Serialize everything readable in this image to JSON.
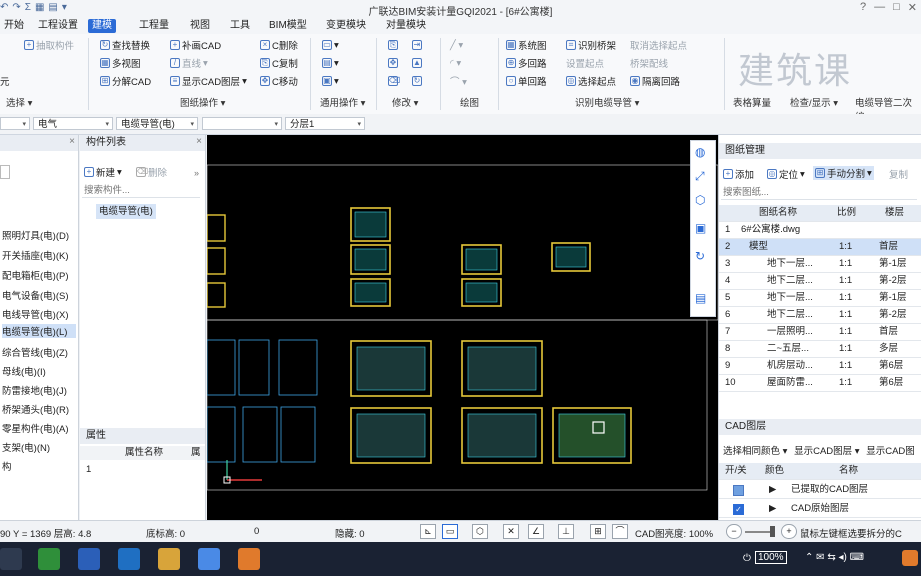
{
  "app_title": "广联达BIM安装计量GQI2021 - [6#公寓楼]",
  "window_controls": [
    "?",
    "—",
    "□",
    "✕"
  ],
  "menu": {
    "tabs": [
      "开始",
      "工程设置",
      "建模",
      "工程量",
      "视图",
      "工具",
      "BIM模型",
      "变更模块",
      "对量模块"
    ],
    "active_index": 2
  },
  "ribbon": {
    "left_partial": {
      "extract_component": "抽取构件",
      "yuan": "元",
      "group_label": "选择"
    },
    "drawing_ops": {
      "find_replace": "查找替换",
      "supplement_cad": "补画CAD",
      "c_delete": "C删除",
      "multi_view": "多视图",
      "line": "直线",
      "c_copy": "C复制",
      "split_cad": "分解CAD",
      "show_cad_layer": "显示CAD图层",
      "c_move": "C移动",
      "group_label": "图纸操作"
    },
    "general_ops_label": "通用操作",
    "modify_label": "修改",
    "draw_label": "绘图",
    "identify_conduit": {
      "system_diagram": "系统图",
      "identify_bridge": "识别桥架",
      "cancel_select_start": "取消选择起点",
      "multi_circuit": "多回路",
      "set_start": "设置起点",
      "bridge_check": "桥架配线",
      "single_circuit": "单回路",
      "select_start": "选择起点",
      "isolate_circuit": "隔离回路",
      "group_label": "识别电缆导管"
    },
    "table_calc_label": "表格算量",
    "check_show_label": "检查/显示",
    "conduit_secondary_label": "电缆导管二次编",
    "watermark": "建筑课"
  },
  "combos": [
    {
      "value": "",
      "name": "combo-blank"
    },
    {
      "value": "电气"
    },
    {
      "value": "电缆导管(电)"
    },
    {
      "value": ""
    },
    {
      "value": "分层1"
    }
  ],
  "left_tree": {
    "items": [
      "照明灯具(电)(D)",
      "开关插座(电)(K)",
      "配电箱柜(电)(P)",
      "电气设备(电)(S)",
      "电线导管(电)(X)",
      "电缆导管(电)(L)",
      "综合管线(电)(Z)",
      "母线(电)(I)",
      "防雷接地(电)(J)",
      "桥架通头(电)(R)",
      "零星构件(电)(A)",
      "支架(电)(N)",
      "构"
    ],
    "selected_index": 5
  },
  "component_list": {
    "title": "构件列表",
    "new_label": "新建",
    "delete_label": "删除",
    "search_placeholder": "搜索构件...",
    "items": [
      "电缆导管(电)"
    ]
  },
  "properties": {
    "title": "属性",
    "col_name": "属性名称",
    "col_value": "属",
    "rows": [
      "1"
    ]
  },
  "drawing_manager": {
    "title": "图纸管理",
    "add": "添加",
    "locate": "定位",
    "manual_split": "手动分割",
    "copy": "复制",
    "search_placeholder": "搜索图纸...",
    "columns": [
      "图纸名称",
      "比例",
      "楼层"
    ],
    "rows": [
      {
        "no": "1",
        "name": "6#公寓楼.dwg",
        "scale": "",
        "floor": ""
      },
      {
        "no": "2",
        "name": "模型",
        "scale": "1:1",
        "floor": "首层"
      },
      {
        "no": "3",
        "name": "地下一层...",
        "scale": "1:1",
        "floor": "第-1层"
      },
      {
        "no": "4",
        "name": "地下二层...",
        "scale": "1:1",
        "floor": "第-2层"
      },
      {
        "no": "5",
        "name": "地下一层...",
        "scale": "1:1",
        "floor": "第-1层"
      },
      {
        "no": "6",
        "name": "地下二层...",
        "scale": "1:1",
        "floor": "第-2层"
      },
      {
        "no": "7",
        "name": "一层照明...",
        "scale": "1:1",
        "floor": "首层"
      },
      {
        "no": "8",
        "name": "二~五层...",
        "scale": "1:1",
        "floor": "多层"
      },
      {
        "no": "9",
        "name": "机房层动...",
        "scale": "1:1",
        "floor": "第6层"
      },
      {
        "no": "10",
        "name": "屋面防雷...",
        "scale": "1:1",
        "floor": "第6层"
      }
    ]
  },
  "cad_layers": {
    "title": "CAD图层",
    "select_same_color": "选择相同颜色",
    "show_cad_layer": "显示CAD图层",
    "show_cad_short": "显示CAD图",
    "columns": [
      "开/关",
      "颜色",
      "名称"
    ],
    "rows": [
      {
        "name": "已提取的CAD图层",
        "checked": false
      },
      {
        "name": "CAD原始图层",
        "checked": true
      }
    ]
  },
  "statusbar": {
    "coords": "90 Y = 1369 层高: 4.8",
    "base_height": "底标高: 0",
    "zero": "0",
    "hidden": "隐藏: 0",
    "cad_brightness": "CAD图亮度: 100%",
    "hint": "鼠标左键框选要拆分的C"
  },
  "taskbar": {
    "battery": "100%",
    "icons": [
      "task-view",
      "camtasia",
      "word",
      "cad-viewer",
      "file-explorer",
      "app-a",
      "camtasia-2"
    ]
  }
}
